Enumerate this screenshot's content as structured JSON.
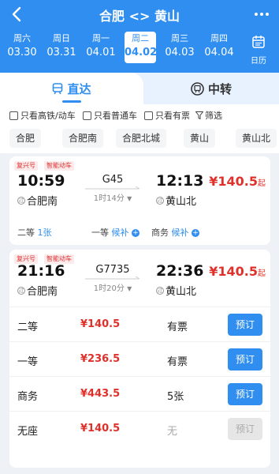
{
  "header": {
    "route": "合肥 <> 黄山",
    "calendar_label": "日历",
    "dates": [
      {
        "week": "周六",
        "date": "03.30"
      },
      {
        "week": "周日",
        "date": "03.31"
      },
      {
        "week": "周一",
        "date": "04.01"
      },
      {
        "week": "周二",
        "date": "04.02",
        "selected": true
      },
      {
        "week": "周三",
        "date": "04.03"
      },
      {
        "week": "周四",
        "date": "04.04"
      }
    ]
  },
  "tabs": {
    "direct": "直达",
    "transfer": "中转"
  },
  "filters": [
    "只看高铁/动车",
    "只看普通车",
    "只看有票",
    "筛选"
  ],
  "stations": [
    "合肥",
    "合肥南",
    "合肥北城",
    "黄山",
    "黄山北"
  ],
  "trains": [
    {
      "badges": [
        "复兴号",
        "智能动车"
      ],
      "depart_time": "10:59",
      "depart_station": "合肥南",
      "train_no": "G45",
      "duration": "1时14分",
      "arrive_time": "12:13",
      "arrive_station": "黄山北",
      "price": "¥140.5",
      "price_suffix": "起",
      "seats": [
        {
          "class": "二等",
          "status": "1张"
        },
        {
          "class": "一等",
          "status": "候补"
        },
        {
          "class": "商务",
          "status": "候补"
        }
      ]
    },
    {
      "badges": [
        "复兴号",
        "智能动车"
      ],
      "depart_time": "21:16",
      "depart_station": "合肥南",
      "train_no": "G7735",
      "duration": "1时20分",
      "arrive_time": "22:36",
      "arrive_station": "黄山北",
      "price": "¥140.5",
      "price_suffix": "起",
      "rows": [
        {
          "class": "二等",
          "price": "¥140.5",
          "avail": "有票",
          "btn": "预订"
        },
        {
          "class": "一等",
          "price": "¥236.5",
          "avail": "有票",
          "btn": "预订"
        },
        {
          "class": "商务",
          "price": "¥443.5",
          "avail": "5张",
          "btn": "预订"
        },
        {
          "class": "无座",
          "price": "¥140.5",
          "avail": "无",
          "btn": "预订"
        }
      ]
    }
  ],
  "colors": {
    "primary": "#2f8ef0",
    "price": "#e0302a"
  }
}
